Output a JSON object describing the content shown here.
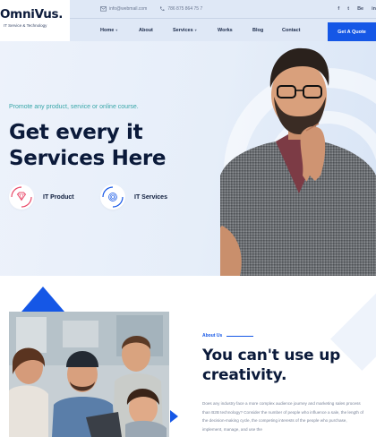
{
  "brand": {
    "name": "OmniVus.",
    "tagline": "IT Service & Technology"
  },
  "topbar": {
    "email": "info@webmail.com",
    "phone": "786 875 864 75 7",
    "social": [
      "f",
      "t",
      "Be",
      "in"
    ]
  },
  "nav": {
    "items": [
      "Home",
      "About",
      "Services",
      "Works",
      "Blog",
      "Contact"
    ],
    "cta": "Get A Quote"
  },
  "hero": {
    "promo": "Promote any product, service or online course.",
    "title_line1": "Get every it",
    "title_line2": "Services Here",
    "features": [
      {
        "label": "IT Product",
        "icon": "diamond-icon"
      },
      {
        "label": "IT Services",
        "icon": "fingerprint-icon"
      }
    ]
  },
  "about": {
    "label": "About Us",
    "title_line1": "You can't use up",
    "title_line2": "creativity.",
    "text": "Does any industry face a more complex audience journey and marketing sales process than B2B technology? Consider the number of people who influence a sale, the length of the decision-making cycle, the competing interests of the people who purchase, implement, manage, and use the"
  },
  "colors": {
    "accent": "#1557e6",
    "heading": "#0b1a3a",
    "promo": "#38a6a8",
    "hero_bg": "#e6eef9"
  }
}
